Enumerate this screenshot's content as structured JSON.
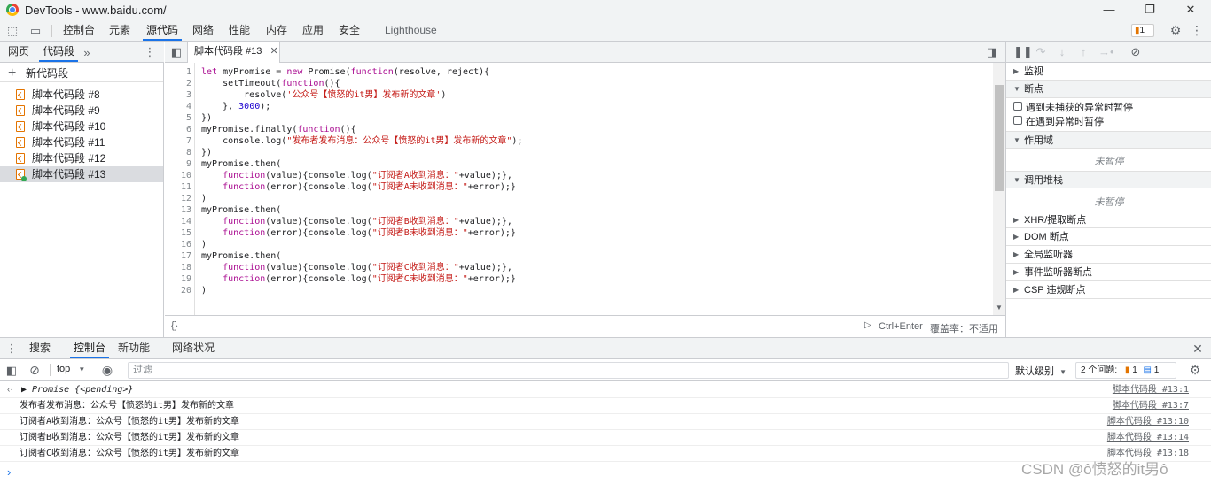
{
  "window": {
    "title": "DevTools - www.baidu.com/"
  },
  "main_tabs": [
    "控制台",
    "元素",
    "源代码",
    "网络",
    "性能",
    "内存",
    "应用",
    "安全",
    "Lighthouse"
  ],
  "issues_badge": "1",
  "left_pane": {
    "tabs": [
      "网页",
      "代码段"
    ],
    "new_snippet": "新代码段",
    "snippets": [
      "脚本代码段 #8",
      "脚本代码段 #9",
      "脚本代码段 #10",
      "脚本代码段 #11",
      "脚本代码段 #12",
      "脚本代码段 #13"
    ]
  },
  "editor": {
    "tab_title": "脚本代码段 #13",
    "line_numbers": [
      "1",
      "2",
      "3",
      "4",
      "5",
      "6",
      "7",
      "8",
      "9",
      "10",
      "11",
      "12",
      "13",
      "14",
      "15",
      "16",
      "17",
      "18",
      "19",
      "20"
    ],
    "code_lines": [
      "let myPromise = new Promise(function(resolve, reject){",
      "    setTimeout(function(){",
      "        resolve('公众号【愤怒的it男】发布新的文章')",
      "    }, 3000);",
      "})",
      "myPromise.finally(function(){",
      "    console.log(\"发布者发布消息：公众号【愤怒的it男】发布新的文章\");",
      "})",
      "myPromise.then(",
      "    function(value){console.log(\"订阅者A收到消息：\"+value);},",
      "    function(error){console.log(\"订阅者A未收到消息：\"+error);}",
      ")",
      "myPromise.then(",
      "    function(value){console.log(\"订阅者B收到消息：\"+value);},",
      "    function(error){console.log(\"订阅者B未收到消息：\"+error);}",
      ")",
      "myPromise.then(",
      "    function(value){console.log(\"订阅者C收到消息：\"+value);},",
      "    function(error){console.log(\"订阅者C未收到消息：\"+error);}",
      ")"
    ],
    "footer_run": "Ctrl+Enter",
    "footer_coverage": "覆盖率：不适用",
    "format_icon": "{}"
  },
  "right_pane": {
    "sections": {
      "watch": "监视",
      "breakpoints": "断点",
      "pause_uncaught": "遇到未捕获的异常时暂停",
      "pause_caught": "在遇到异常时暂停",
      "scope": "作用域",
      "scope_status": "未暂停",
      "callstack": "调用堆栈",
      "callstack_status": "未暂停",
      "xhr": "XHR/提取断点",
      "dom": "DOM 断点",
      "global": "全局监听器",
      "event": "事件监听器断点",
      "csp": "CSP 违规断点"
    }
  },
  "drawer": {
    "tabs": [
      "搜索",
      "控制台",
      "新功能",
      "网络状况"
    ],
    "context": "top",
    "filter_placeholder": "过滤",
    "log_level": "默认级别",
    "issues_text": "2 个问题:",
    "issues_warn": "1",
    "issues_info": "1",
    "rows": [
      {
        "msg": "▶ Promise {<pending>}",
        "src": "脚本代码段 #13:1"
      },
      {
        "msg": "发布者发布消息：公众号【愤怒的it男】发布新的文章",
        "src": "脚本代码段 #13:7"
      },
      {
        "msg": "订阅者A收到消息：公众号【愤怒的it男】发布新的文章",
        "src": "脚本代码段 #13:10"
      },
      {
        "msg": "订阅者B收到消息：公众号【愤怒的it男】发布新的文章",
        "src": "脚本代码段 #13:14"
      },
      {
        "msg": "订阅者C收到消息：公众号【愤怒的it男】发布新的文章",
        "src": "脚本代码段 #13:18"
      }
    ],
    "prompt": "›"
  },
  "watermark": "CSDN @ô愤怒的it男ô",
  "colors": {
    "accent": "#1a73e8",
    "keyword": "#aa0d91",
    "string": "#c41a16",
    "snippet_icon": "#e37400"
  }
}
